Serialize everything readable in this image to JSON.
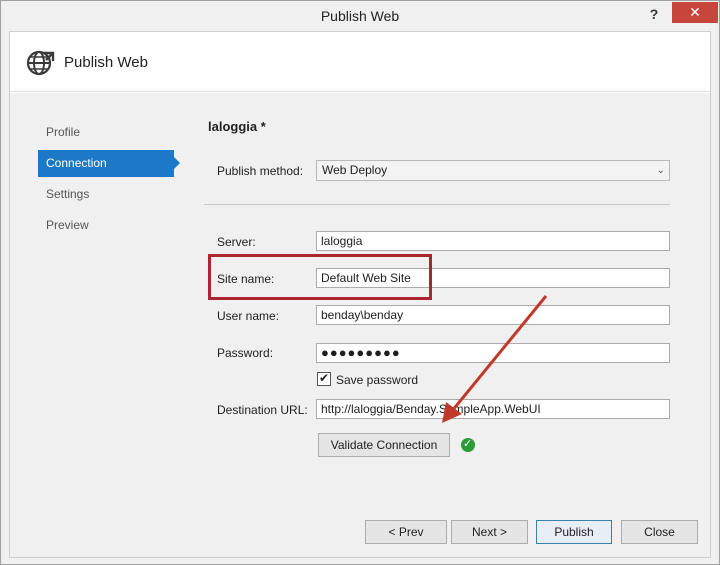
{
  "window": {
    "title": "Publish Web",
    "help_label": "?",
    "close_label": "✕"
  },
  "header": {
    "title": "Publish Web",
    "icon": "globe-publish-icon"
  },
  "nav": {
    "items": [
      {
        "label": "Profile",
        "active": false
      },
      {
        "label": "Connection",
        "active": true
      },
      {
        "label": "Settings",
        "active": false
      },
      {
        "label": "Preview",
        "active": false
      }
    ]
  },
  "connection": {
    "profile_name": "laloggia *",
    "publish_method_label": "Publish method:",
    "publish_method_value": "Web Deploy",
    "server_label": "Server:",
    "server_value": "laloggia",
    "site_name_label": "Site name:",
    "site_name_value": "Default Web Site",
    "user_name_label": "User name:",
    "user_name_value": "benday\\benday",
    "password_label": "Password:",
    "password_value": "●●●●●●●●●",
    "save_password_label": "Save password",
    "save_password_checked": true,
    "destination_url_label": "Destination URL:",
    "destination_url_value": "http://laloggia/Benday.SampleApp.WebUI",
    "validate_button_label": "Validate Connection",
    "validation_status": "success-check-icon"
  },
  "footer": {
    "prev_label": "< Prev",
    "next_label": "Next >",
    "publish_label": "Publish",
    "close_label": "Close"
  },
  "annotation": {
    "highlight_color": "#a9262f",
    "arrow_color": "#c0392b"
  },
  "colors": {
    "accent": "#1c79c8",
    "success": "#2e9b3a"
  }
}
